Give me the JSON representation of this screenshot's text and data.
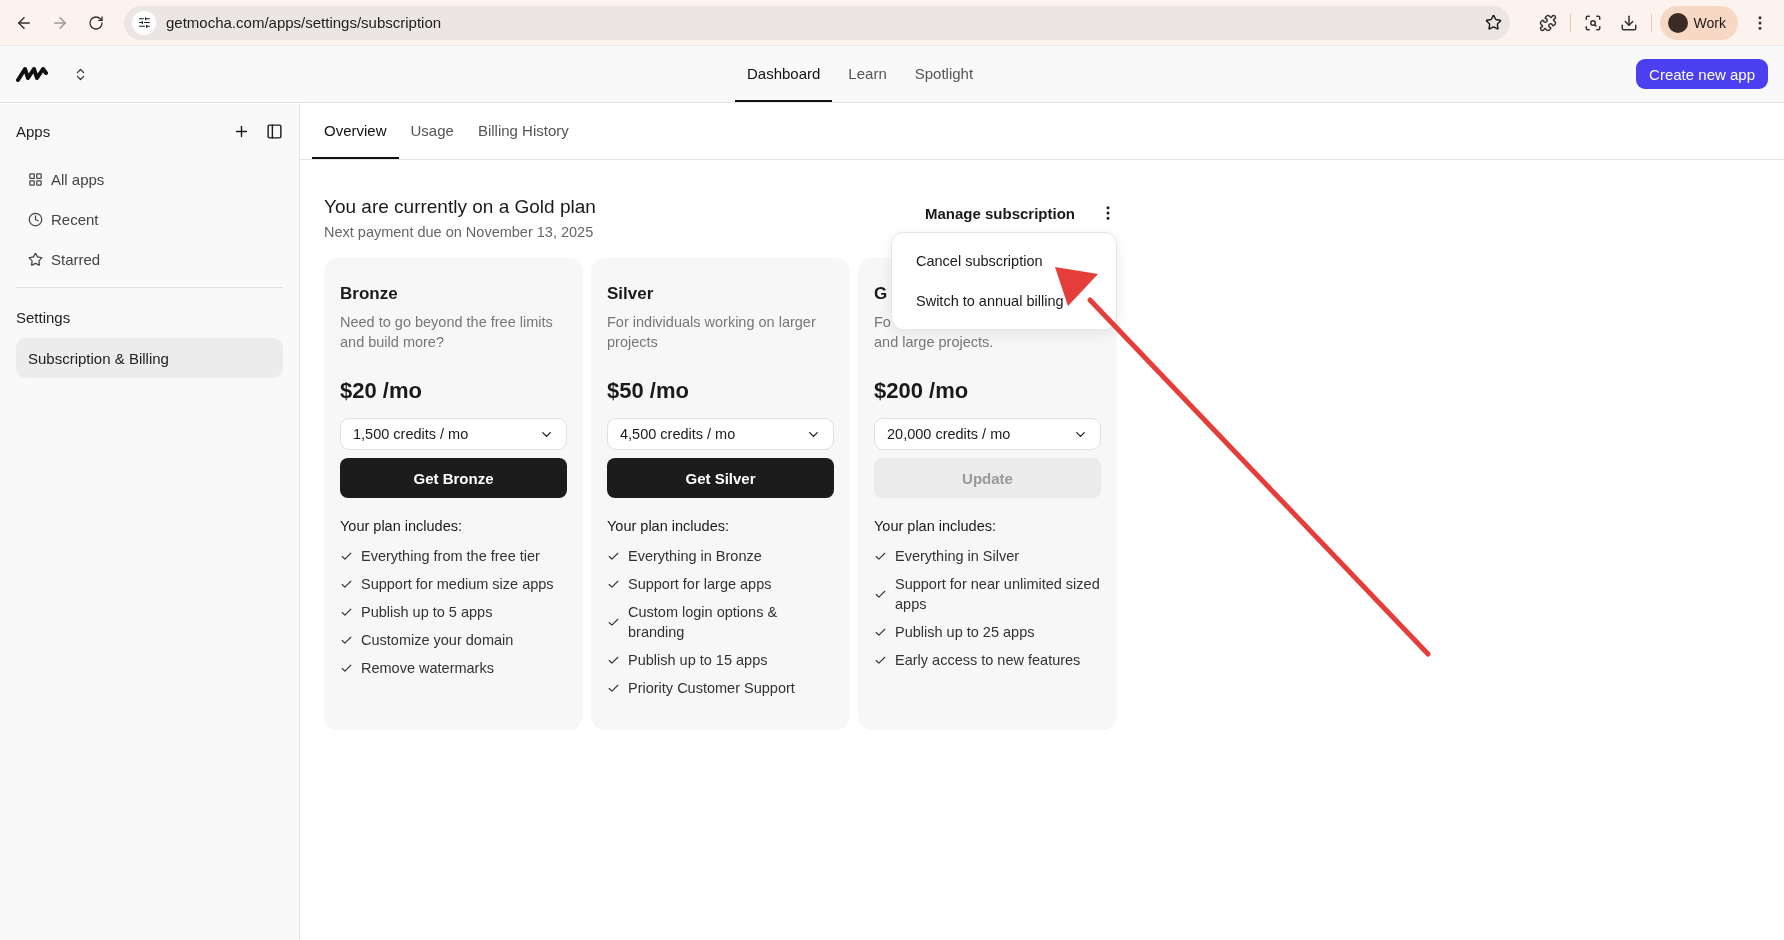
{
  "browser": {
    "url": "getmocha.com/apps/settings/subscription",
    "profile": "Work"
  },
  "top_nav": {
    "items": [
      {
        "label": "Dashboard",
        "selected": true
      },
      {
        "label": "Learn",
        "selected": false
      },
      {
        "label": "Spotlight",
        "selected": false
      }
    ],
    "create_button": "Create new app"
  },
  "sidebar": {
    "apps_title": "Apps",
    "items": [
      {
        "label": "All apps",
        "kind": "grid",
        "selected": false
      },
      {
        "label": "Recent",
        "kind": "clock",
        "selected": false
      },
      {
        "label": "Starred",
        "kind": "star",
        "selected": false
      }
    ],
    "settings_title": "Settings",
    "settings_items": [
      {
        "label": "Subscription & Billing",
        "selected": true
      }
    ]
  },
  "tabs": [
    {
      "label": "Overview",
      "selected": true
    },
    {
      "label": "Usage",
      "selected": false
    },
    {
      "label": "Billing History",
      "selected": false
    }
  ],
  "plan_header": {
    "title": "You are currently on a Gold plan",
    "subtitle": "Next payment due on November 13, 2025",
    "manage_label": "Manage subscription"
  },
  "menu": {
    "items": [
      "Cancel subscription",
      "Switch to annual billing"
    ]
  },
  "plans": [
    {
      "name": "Bronze",
      "description": [
        "Need to go beyond the free limits",
        "and build more?"
      ],
      "price": "$20 /mo",
      "credits": "1,500 credits / mo",
      "button": {
        "label": "Get Bronze",
        "disabled": false
      },
      "includes_label": "Your plan includes:",
      "features": [
        "Everything from the free tier",
        "Support for medium size apps",
        "Publish up to 5 apps",
        "Customize your domain",
        "Remove watermarks"
      ]
    },
    {
      "name": "Silver",
      "description": [
        "For individuals working on larger",
        "projects"
      ],
      "price": "$50 /mo",
      "credits": "4,500 credits / mo",
      "button": {
        "label": "Get Silver",
        "disabled": false
      },
      "includes_label": "Your plan includes:",
      "features": [
        "Everything in Bronze",
        "Support for large apps",
        "Custom login options & branding",
        "Publish up to 15 apps",
        "Priority Customer Support"
      ]
    },
    {
      "name": "G",
      "description": [
        "Fo",
        "and large projects."
      ],
      "price": "$200 /mo",
      "credits": "20,000 credits / mo",
      "button": {
        "label": "Update",
        "disabled": true
      },
      "includes_label": "Your plan includes:",
      "features": [
        "Everything in Silver",
        "Support for near unlimited sized apps",
        "Publish up to 25 apps",
        "Early access to new features"
      ]
    }
  ]
}
